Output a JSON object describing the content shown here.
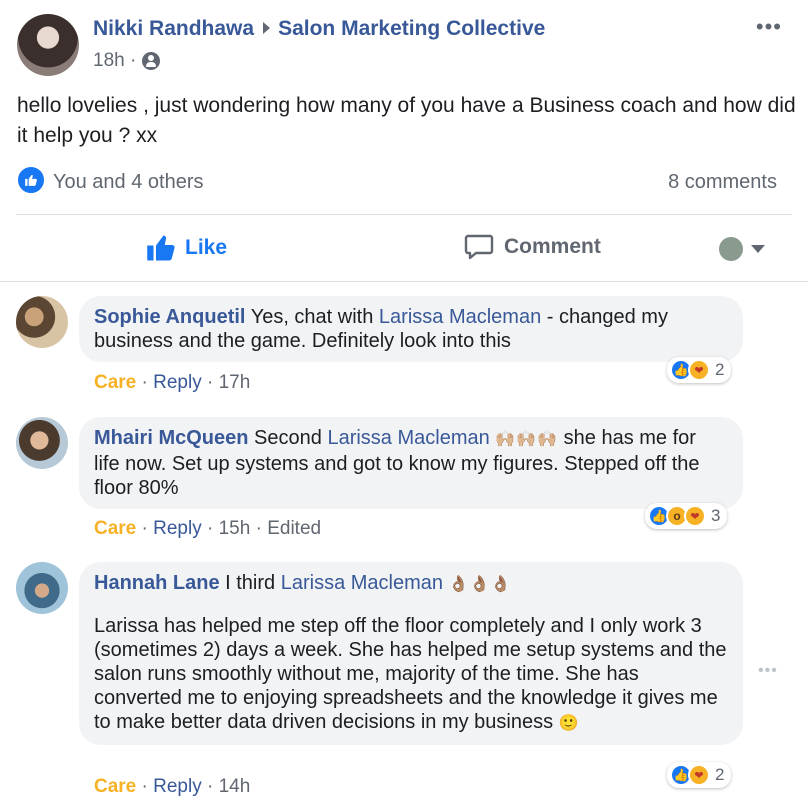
{
  "post": {
    "author": "Nikki Randhawa",
    "group": "Salon Marketing Collective",
    "time": "18h ·",
    "text": "hello lovelies , just wondering how many of you have a Business coach and how did it help you ? xx",
    "reactions_text": "You and 4 others",
    "comments_count": "8 comments",
    "more_icon": "•••"
  },
  "actions": {
    "like_label": "Like",
    "comment_label": "Comment"
  },
  "comments": [
    {
      "author": "Sophie Anquetil",
      "text_before": "Yes, chat with",
      "mention": "Larissa Macleman",
      "text_after": "- changed my business and the game. Definitely look into this",
      "care": "Care",
      "sep1": "·",
      "reply": "Reply",
      "sep2": "·",
      "time": "17h",
      "edited": "",
      "reaction_count": "2"
    },
    {
      "author": "Mhairi McQueen",
      "text_before": "Second",
      "mention": "Larissa Macleman",
      "emojis": "🙌🏼🙌🏼🙌🏼",
      "text_after": "she has me for life now. Set up systems and got to know my figures. Stepped off the floor 80%",
      "care": "Care",
      "sep1": "·",
      "reply": "Reply",
      "sep2": "·",
      "time": "15h",
      "edited": "· Edited",
      "reaction_count": "3"
    },
    {
      "author": "Hannah Lane",
      "text_before": "I third",
      "mention": "Larissa Macleman",
      "emojis": "👌🏽👌🏽👌🏽",
      "paragraph": "Larissa has helped me step off the floor completely and I only work 3 (sometimes 2) days a week. She has helped me setup systems and the salon runs smoothly without me, majority of the time. She has converted me to enjoying spreadsheets and the knowledge it gives me to make better data driven decisions in my business",
      "end_emoji": "🙂",
      "care": "Care",
      "sep1": "·",
      "reply": "Reply",
      "sep2": "·",
      "time": "14h",
      "reaction_count": "2"
    }
  ],
  "colors": {
    "link": "#385898",
    "care": "#f7b125",
    "like_blue": "#1877f2",
    "bubble": "#f2f3f5"
  }
}
